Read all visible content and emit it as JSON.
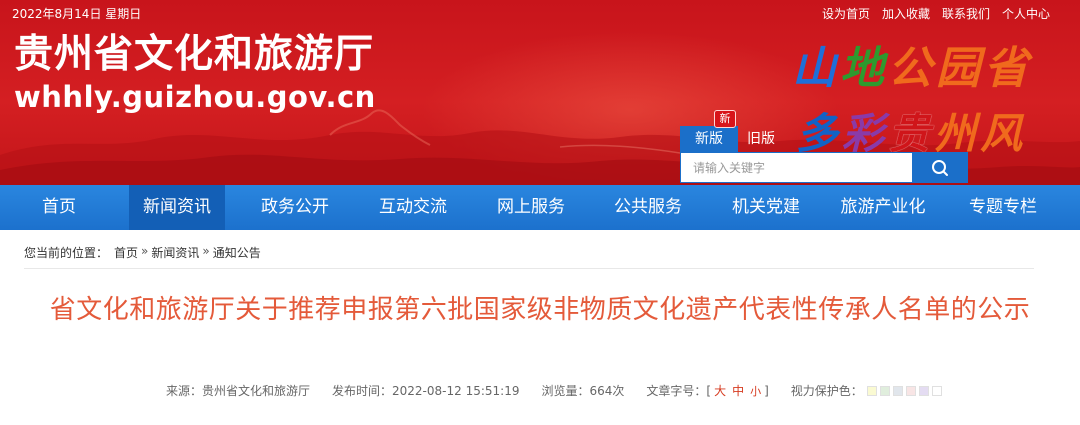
{
  "topbar": {
    "date": "2022年8月14日   星期日",
    "links": [
      {
        "label": "设为首页"
      },
      {
        "label": "加入收藏"
      },
      {
        "label": "联系我们"
      },
      {
        "label": "个人中心"
      }
    ]
  },
  "site": {
    "name": "贵州省文化和旅游厅",
    "url": "whhly.guizhou.gov.cn"
  },
  "slogan": {
    "line1": [
      "山",
      "地",
      "公",
      "园",
      "省"
    ],
    "line2": [
      "多",
      "彩",
      "贵",
      "州",
      "风"
    ]
  },
  "version": {
    "badge": "新",
    "new_label": "新版",
    "old_label": "旧版"
  },
  "search": {
    "placeholder": "请输入关键字"
  },
  "nav": {
    "items": [
      {
        "label": "首页"
      },
      {
        "label": "新闻资讯"
      },
      {
        "label": "政务公开"
      },
      {
        "label": "互动交流"
      },
      {
        "label": "网上服务"
      },
      {
        "label": "公共服务"
      },
      {
        "label": "机关党建"
      },
      {
        "label": "旅游产业化"
      },
      {
        "label": "专题专栏"
      }
    ],
    "active_index": 1
  },
  "breadcrumb": {
    "prefix": "您当前的位置：",
    "items": [
      "首页",
      "新闻资讯",
      "通知公告"
    ],
    "separator": "»"
  },
  "article": {
    "title": "省文化和旅游厅关于推荐申报第六批国家级非物质文化遗产代表性传承人名单的公示",
    "source": "来源：贵州省文化和旅游厅",
    "published": "发布时间：2022-08-12 15:51:19",
    "views": "浏览量：664次",
    "font_size_label": "文章字号：[",
    "font_large": "大",
    "font_medium": "中",
    "font_small": "小",
    "font_size_end": "]",
    "eye_care_label": "视力保护色：",
    "eye_care_colors": [
      "#fafad2",
      "#e0eedd",
      "#e1e6ec",
      "#f8e5e5",
      "#e4dcf2",
      "#ffffff"
    ]
  },
  "colors": {
    "banner_red": "#d41f22",
    "nav_blue": "#1c71cd",
    "nav_active": "#135fb6",
    "title_color": "#e45a3a"
  }
}
